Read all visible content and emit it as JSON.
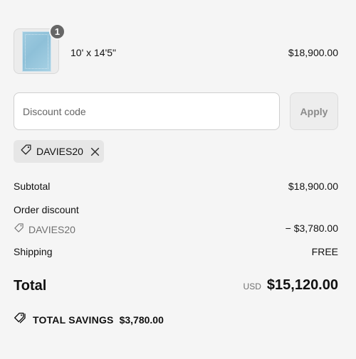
{
  "product": {
    "quantity": "1",
    "title": "10' x 14'5\"",
    "price": "$18,900.00",
    "thumbnail_icon": "rug-image"
  },
  "discount": {
    "placeholder": "Discount code",
    "apply_label": "Apply",
    "applied_code": "DAVIES20"
  },
  "summary": {
    "subtotal_label": "Subtotal",
    "subtotal_value": "$18,900.00",
    "order_discount_label": "Order discount",
    "discount_code": "DAVIES20",
    "discount_value": "− $3,780.00",
    "shipping_label": "Shipping",
    "shipping_value": "FREE",
    "total_label": "Total",
    "currency": "USD",
    "total_value": "$15,120.00",
    "savings_label": "TOTAL SAVINGS",
    "savings_value": "$3,780.00"
  },
  "colors": {
    "background": "#f5f5f5",
    "badge": "#666666",
    "muted_text": "#707070"
  }
}
